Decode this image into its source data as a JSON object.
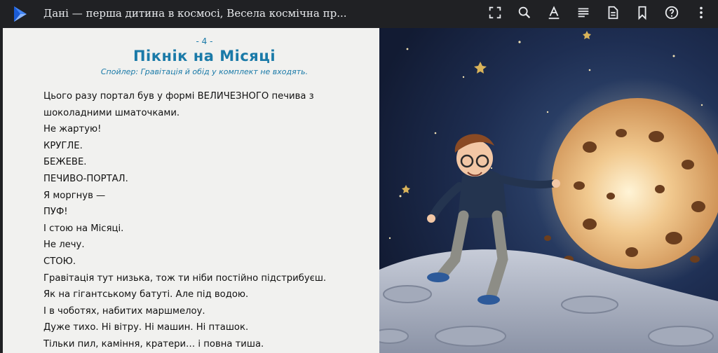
{
  "header": {
    "title": "Дані — перша дитина в космосі, Весела космічна пр...",
    "icons": [
      "app-logo-icon",
      "fullscreen-icon",
      "search-icon",
      "text-format-icon",
      "contents-icon",
      "page-info-icon",
      "bookmark-icon",
      "help-icon",
      "more-vert-icon"
    ]
  },
  "page": {
    "number": "- 4 -",
    "chapter_title": "Пікнік на Місяці",
    "chapter_subtitle": "Спойлер: Гравітація й обід у комплект не входять.",
    "paragraphs": [
      "Цього разу портал був у формі ВЕЛИЧЕЗНОГО печива з",
      "шоколадними шматочками.",
      "Не жартую!",
      "КРУГЛЕ.",
      "БЕЖЕВЕ.",
      "ПЕЧИВО-ПОРТАЛ.",
      "Я моргнув —",
      "ПУФ!",
      "І стою на Місяці.",
      "Не лечу.",
      "СТОЮ.",
      "Гравітація тут низька, тож ти ніби постійно підстрибуєш.",
      "Як на гігантському батуті. Але під водою.",
      "І в чоботях, набитих маршмелоу.",
      "Дуже тихо. Ні вітру. Ні машин. Ні пташок.",
      "Тільки пил, каміння, кратери… і повна тиша."
    ]
  },
  "colors": {
    "topbar": "#202124",
    "accent": "#1a7aa8",
    "page_bg": "#f1f1ef",
    "space": "#1d2b4a",
    "cookie": "#e3b57e"
  }
}
